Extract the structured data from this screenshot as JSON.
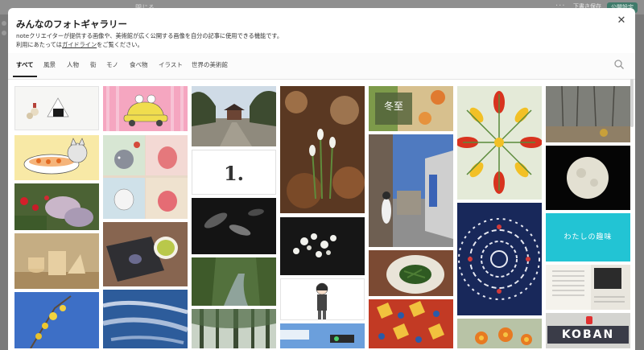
{
  "background": {
    "top_text": "閉じる",
    "draft_label": "下書き保存",
    "publish_label": "公開設定"
  },
  "modal": {
    "title": "みんなのフォトギャラリー",
    "description_line1": "noteクリエイターが提供する画像や、美術館が広く公開する画像を自分の記事に使用できる機能です。",
    "description_prefix": "利用にあたっては",
    "guideline_link": "ガイドライン",
    "description_suffix": "をご覧ください。",
    "close_icon": "close-icon",
    "search_icon": "search-icon"
  },
  "tabs": [
    "すべて",
    "風景",
    "人物",
    "街",
    "モノ",
    "食べ物",
    "イラスト",
    "世界の美術館"
  ],
  "tiles": {
    "number_one": "1.",
    "touji": "冬至",
    "watashi": "わたしの趣味",
    "koban": "KOBAN"
  },
  "colors": {
    "accent": "#222222",
    "teal_tile": "#1fc0cf",
    "publish_button": "#3f7a6a"
  }
}
